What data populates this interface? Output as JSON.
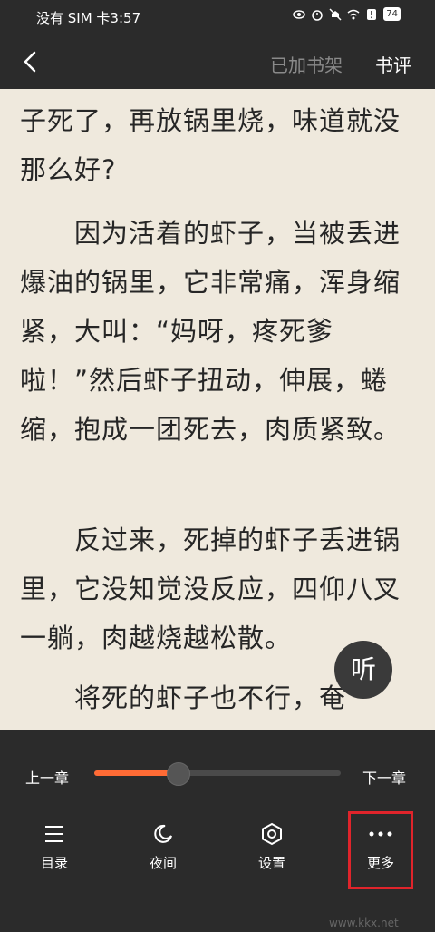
{
  "status_bar": {
    "carrier_time": "没有 SIM 卡3:57",
    "icons": [
      "eye-icon",
      "alarm-icon",
      "mute-icon",
      "wifi-icon",
      "alert-icon"
    ],
    "battery": "74"
  },
  "nav": {
    "added_to_shelf": "已加书架",
    "review": "书评"
  },
  "content": {
    "paragraphs": [
      "子死了，再放锅里烧，味道就没那么好?",
      "　　因为活着的虾子，当被丢进爆油的锅里，它非常痛，浑身缩紧，大叫：“妈呀，疼死爹啦！”然后虾子扭动，伸展，蜷缩，抱成一团死去，肉质紧致。",
      "　　反过来，死掉的虾子丢进锅里，它没知觉没反应，四仰八叉一躺，肉越烧越松散。",
      "　　将死的虾子也不行，奄"
    ],
    "listen_label": "听"
  },
  "progress": {
    "prev_chapter": "上一章",
    "next_chapter": "下一章",
    "value": 0.34,
    "accent": "#ff6b35"
  },
  "tabs": {
    "toc": "目录",
    "night": "夜间",
    "settings": "设置",
    "more": "更多"
  },
  "watermark": "www.kkx.net"
}
